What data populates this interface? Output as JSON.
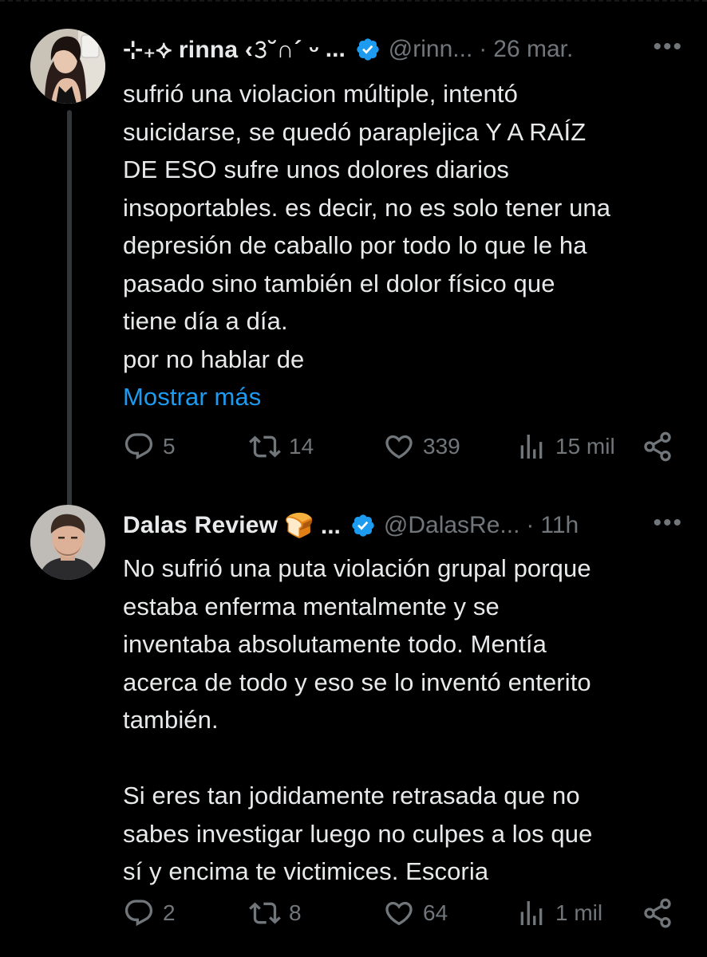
{
  "tweets": [
    {
      "display_name": "⊹₊⟡ rinna ‹𝟹˘∩´ ᵕ",
      "name_ellipsis": "...",
      "handle": "@rinn...",
      "separator": "·",
      "time": "26 mar.",
      "more_label": "•••",
      "text": "sufrió una violacion múltiple, intentó\nsuicidarse, se quedó paraplejica Y A RAÍZ\nDE ESO sufre unos dolores diarios\ninsoportables. es decir, no es solo tener una\ndepresión de caballo por todo lo que le ha\npasado sino también el dolor físico que\ntiene día a día.\npor no hablar de",
      "show_more": "Mostrar más",
      "replies": "5",
      "reposts": "14",
      "likes": "339",
      "views": "15 mil"
    },
    {
      "display_name": "Dalas Review",
      "name_ellipsis": "🍞 ...",
      "handle": "@DalasRe...",
      "separator": "·",
      "time": "11h",
      "more_label": "•••",
      "text": "No sufrió una puta violación grupal porque\nestaba enferma mentalmente y se\ninventaba absolutamente todo. Mentía\nacerca de todo y eso se lo inventó enterito\ntambién.\n\nSi eres tan jodidamente retrasada que no\nsabes investigar luego no culpes a los que\nsí y encima te victimices. Escoria",
      "replies": "2",
      "reposts": "8",
      "likes": "64",
      "views": "1 mil"
    }
  ],
  "colors": {
    "background": "#000000",
    "text": "#e7e9ea",
    "secondary": "#71767b",
    "link": "#1d9bf0",
    "verified": "#1d9bf0",
    "thread_line": "#333639"
  }
}
